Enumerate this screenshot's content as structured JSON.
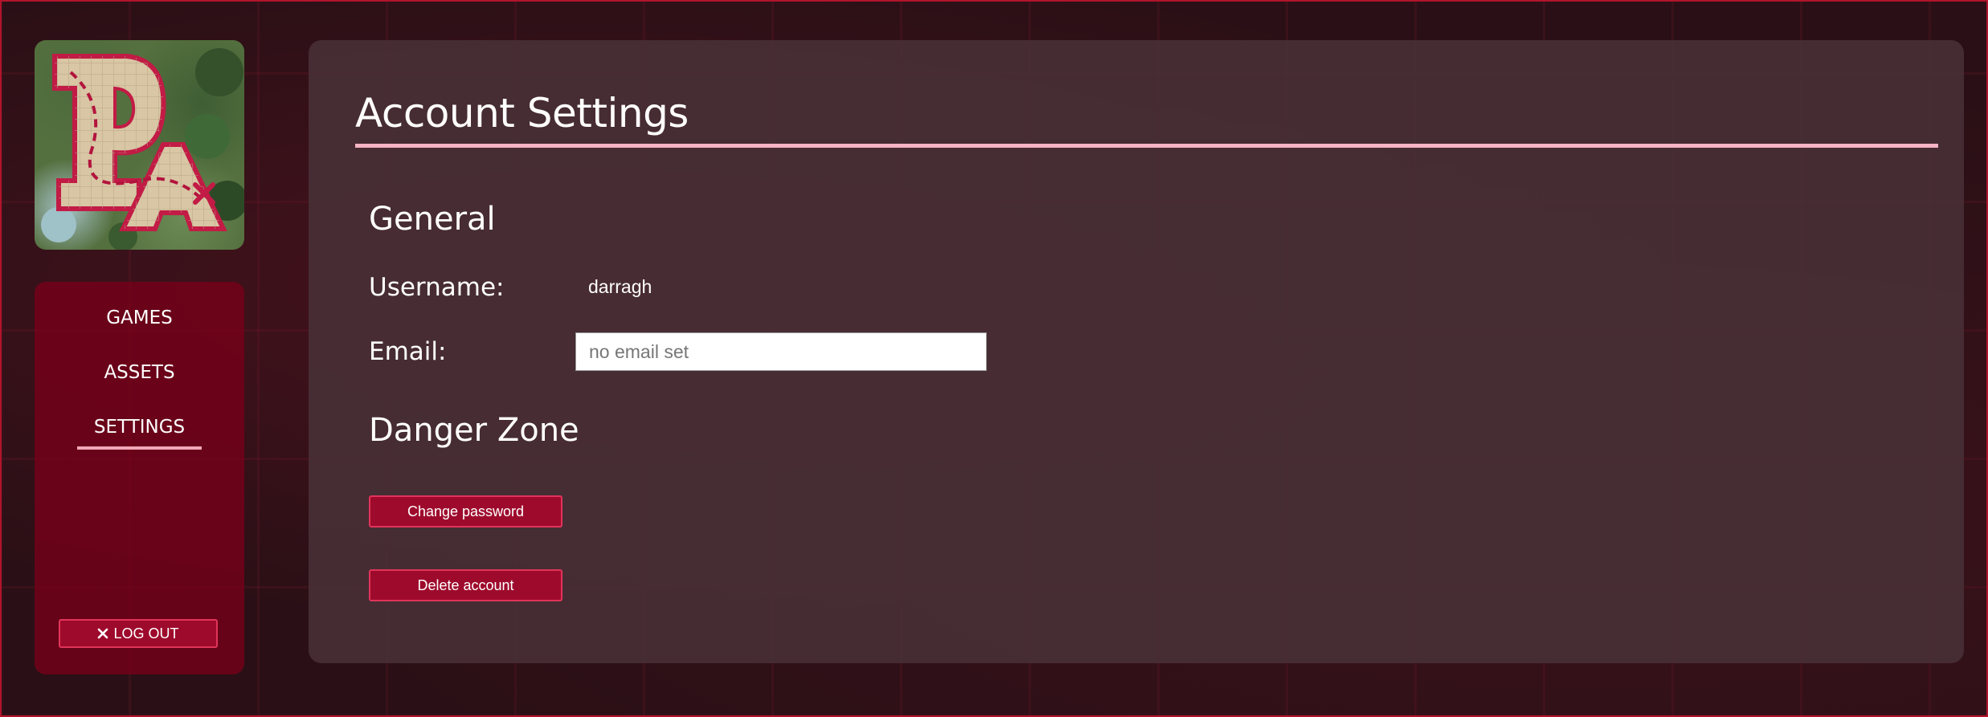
{
  "colors": {
    "accent": "#9e0a2c",
    "accent_border": "#e1345a",
    "underline": "#f6b3c4",
    "panel": "#48303a"
  },
  "sidebar": {
    "logo_icon": "map-logo-icon",
    "nav": [
      {
        "label": "GAMES"
      },
      {
        "label": "ASSETS"
      },
      {
        "label": "SETTINGS",
        "active": true
      }
    ],
    "logout": {
      "icon": "close-icon",
      "label": "LOG OUT"
    }
  },
  "main": {
    "title": "Account Settings",
    "general": {
      "heading": "General",
      "username_label": "Username:",
      "username_value": "darragh",
      "email_label": "Email:",
      "email_placeholder": "no email set",
      "email_value": ""
    },
    "danger": {
      "heading": "Danger Zone",
      "change_password_label": "Change password",
      "delete_account_label": "Delete account"
    }
  }
}
